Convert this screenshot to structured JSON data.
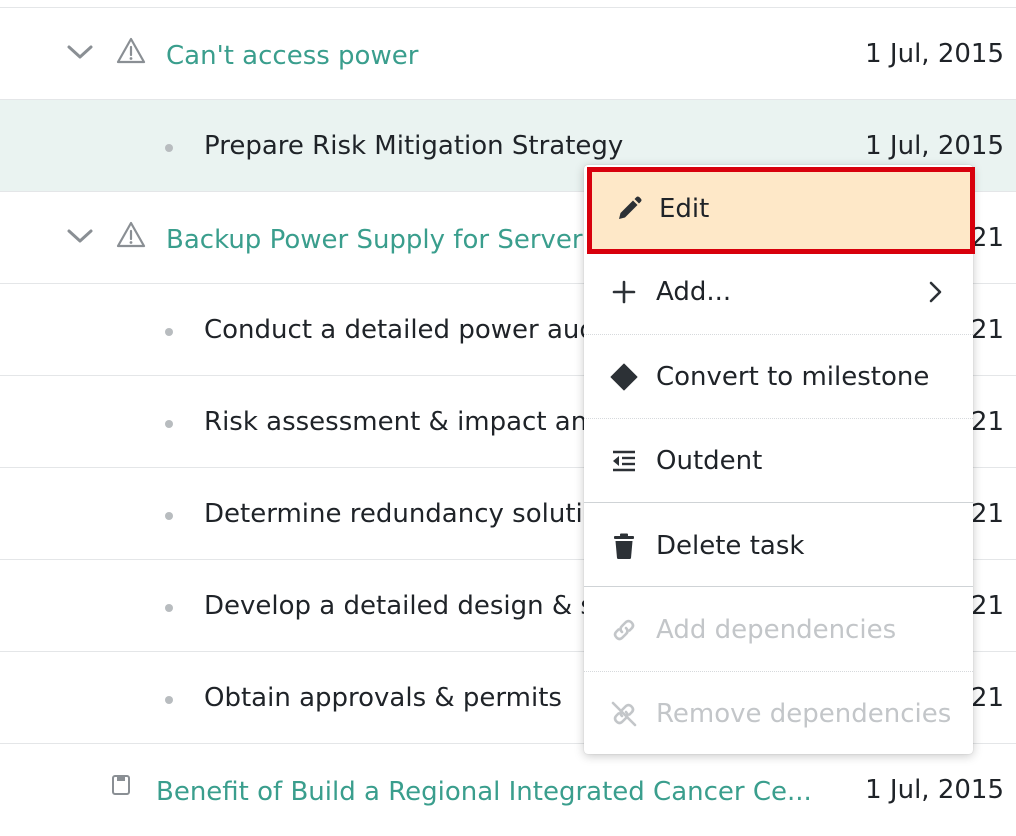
{
  "rows": [
    {
      "type": "parent",
      "title": "Can't access power",
      "date": "1 Jul, 2015"
    },
    {
      "type": "child",
      "title": "Prepare Risk Mitigation Strategy",
      "date": "1 Jul, 2015"
    },
    {
      "type": "parent",
      "title": "Backup Power Supply for Server",
      "date": "21"
    },
    {
      "type": "child",
      "title": "Conduct a detailed power audit",
      "date": "21"
    },
    {
      "type": "child",
      "title": "Risk assessment & impact analysis",
      "date": "21"
    },
    {
      "type": "child",
      "title": "Determine redundancy solution",
      "date": "21"
    },
    {
      "type": "child",
      "title": "Develop a detailed design & spec",
      "date": "21"
    },
    {
      "type": "child",
      "title": "Obtain approvals & permits",
      "date": "21"
    },
    {
      "type": "partial",
      "title": "Benefit of Build a Regional Integrated Cancer Ce...",
      "date": "1 Jul, 2015"
    }
  ],
  "context_menu": {
    "items": [
      {
        "label": "Edit",
        "icon": "pencil-icon",
        "highlighted": true,
        "disabled": false
      },
      {
        "label": "Add...",
        "icon": "plus-icon",
        "submenu": true,
        "disabled": false
      },
      {
        "label": "Convert to milestone",
        "icon": "diamond-icon",
        "disabled": false
      },
      {
        "label": "Outdent",
        "icon": "outdent-icon",
        "disabled": false
      },
      {
        "label": "Delete task",
        "icon": "trash-icon",
        "disabled": false
      },
      {
        "label": "Add dependencies",
        "icon": "link-icon",
        "disabled": true
      },
      {
        "label": "Remove dependencies",
        "icon": "unlink-icon",
        "disabled": true
      }
    ]
  },
  "colors": {
    "accent": "#3a9e8d",
    "selected_row": "#eaf3f1",
    "highlight_fill": "#fee8c8",
    "highlight_border": "#d8000c"
  }
}
